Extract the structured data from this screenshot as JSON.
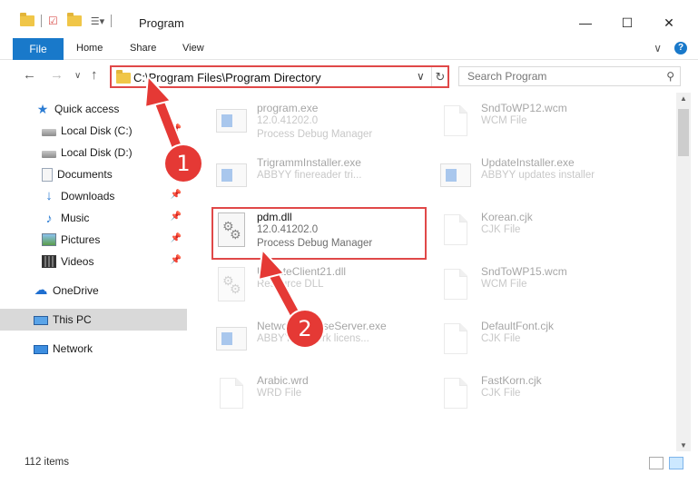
{
  "window": {
    "title": "Program",
    "minimize_glyph": "—",
    "maximize_glyph": "☐",
    "close_glyph": "✕"
  },
  "ribbon": {
    "tabs": [
      "File",
      "Home",
      "Share",
      "View"
    ],
    "collapse_glyph": "∨",
    "help_glyph": "?"
  },
  "address_bar": {
    "path": "C:\\Program Files\\Program Directory",
    "dropdown_glyph": "∨",
    "refresh_glyph": "↻",
    "back_glyph": "←",
    "forward_glyph": "→",
    "recent_glyph": "∨",
    "up_glyph": "↑"
  },
  "search": {
    "placeholder": "Search Program",
    "icon": "search-icon"
  },
  "sidebar": {
    "items": [
      {
        "label": "Quick access",
        "icon": "star-icon"
      },
      {
        "label": "Local Disk (C:)",
        "icon": "disk-icon",
        "pinned": true
      },
      {
        "label": "Local Disk (D:)",
        "icon": "disk-icon",
        "pinned": false
      },
      {
        "label": "Documents",
        "icon": "documents-icon",
        "pinned": true
      },
      {
        "label": "Downloads",
        "icon": "download-icon",
        "pinned": true
      },
      {
        "label": "Music",
        "icon": "music-icon",
        "pinned": true
      },
      {
        "label": "Pictures",
        "icon": "pictures-icon",
        "pinned": true
      },
      {
        "label": "Videos",
        "icon": "videos-icon",
        "pinned": true
      },
      {
        "label": "OneDrive",
        "icon": "cloud-icon"
      },
      {
        "label": "This PC",
        "icon": "computer-icon",
        "selected": true
      },
      {
        "label": "Network",
        "icon": "network-icon"
      }
    ]
  },
  "files": [
    {
      "name": "program.exe",
      "line1": "12.0.41202.0",
      "line2": "Process Debug Manager",
      "icon": "exe-icon",
      "faded": true
    },
    {
      "name": "SndToWP12.wcm",
      "line1": "WCM File",
      "line2": "",
      "icon": "document-icon",
      "faded": true
    },
    {
      "name": "TrigrammInstaller.exe",
      "line1": "ABBYY finereader tri...",
      "line2": "",
      "icon": "exe-icon",
      "faded": true
    },
    {
      "name": "UpdateInstaller.exe",
      "line1": "ABBYY updates installer",
      "line2": "",
      "icon": "exe-icon",
      "faded": true
    },
    {
      "name": "pdm.dll",
      "line1": "12.0.41202.0",
      "line2": "Process Debug Manager",
      "icon": "dll-icon",
      "faded": false
    },
    {
      "name": "Korean.cjk",
      "line1": "CJK File",
      "line2": "",
      "icon": "document-icon",
      "faded": true
    },
    {
      "name": "UpdateClient21.dll",
      "line1": "Resource DLL",
      "line2": "",
      "icon": "dll-icon",
      "faded": true
    },
    {
      "name": "SndToWP15.wcm",
      "line1": "WCM File",
      "line2": "",
      "icon": "document-icon",
      "faded": true
    },
    {
      "name": "NetworkLicenseServer.exe",
      "line1": "ABBYY network licens...",
      "line2": "",
      "icon": "exe-icon",
      "faded": true
    },
    {
      "name": "DefaultFont.cjk",
      "line1": "CJK File",
      "line2": "",
      "icon": "document-icon",
      "faded": true
    },
    {
      "name": "Arabic.wrd",
      "line1": "WRD File",
      "line2": "",
      "icon": "document-icon",
      "faded": true
    },
    {
      "name": "FastKorn.cjk",
      "line1": "CJK File",
      "line2": "",
      "icon": "document-icon",
      "faded": true
    }
  ],
  "status": {
    "item_count": "112 items"
  },
  "annotations": {
    "step1": "1",
    "step2": "2",
    "color": "#e53935"
  }
}
